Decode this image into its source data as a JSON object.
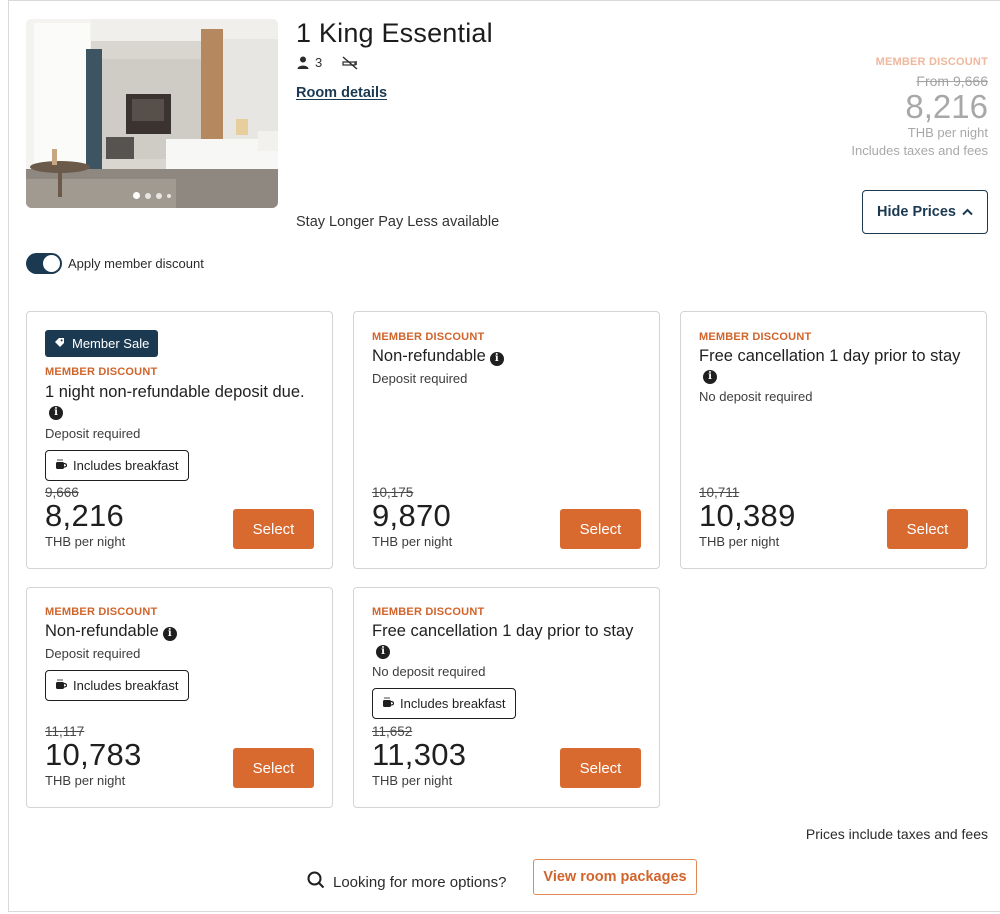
{
  "room": {
    "title": "1 King Essential",
    "guests": "3",
    "guests_icon": "person-icon",
    "smoking_icon": "no-smoking-icon",
    "details_link": "Room details",
    "stay_longer": "Stay Longer Pay Less available",
    "photo_dots": 4
  },
  "header_price": {
    "label": "MEMBER DISCOUNT",
    "from": "From 9,666",
    "price": "8,216",
    "per_night": "THB per night",
    "includes": "Includes taxes and fees",
    "hide_button": "Hide Prices"
  },
  "toggle": {
    "label": "Apply member discount",
    "on": true
  },
  "colors": {
    "navy": "#1b3a52",
    "accent": "#d8692f",
    "discount_label": "#d1642b"
  },
  "rates": [
    {
      "badge": "Member Sale",
      "label": "MEMBER DISCOUNT",
      "title": "1 night non-refundable deposit due.",
      "deposit": "Deposit required",
      "breakfast": "Includes breakfast",
      "old_price": "9,666",
      "price": "8,216",
      "per_night": "THB per night",
      "button": "Select"
    },
    {
      "label": "MEMBER DISCOUNT",
      "title": "Non-refundable",
      "deposit": "Deposit required",
      "old_price": "10,175",
      "price": "9,870",
      "per_night": "THB per night",
      "button": "Select"
    },
    {
      "label": "MEMBER DISCOUNT",
      "title": "Free cancellation 1 day prior to stay",
      "deposit": "No deposit required",
      "old_price": "10,711",
      "price": "10,389",
      "per_night": "THB per night",
      "button": "Select"
    },
    {
      "label": "MEMBER DISCOUNT",
      "title": "Non-refundable",
      "deposit": "Deposit required",
      "breakfast": "Includes breakfast",
      "old_price": "11,117",
      "price": "10,783",
      "per_night": "THB per night",
      "button": "Select"
    },
    {
      "label": "MEMBER DISCOUNT",
      "title": "Free cancellation 1 day prior to stay",
      "deposit": "No deposit required",
      "breakfast": "Includes breakfast",
      "old_price": "11,652",
      "price": "11,303",
      "per_night": "THB per night",
      "button": "Select"
    }
  ],
  "footer": {
    "note": "Prices include taxes and fees",
    "more_options": "Looking for more options?",
    "packages_button": "View room packages"
  }
}
